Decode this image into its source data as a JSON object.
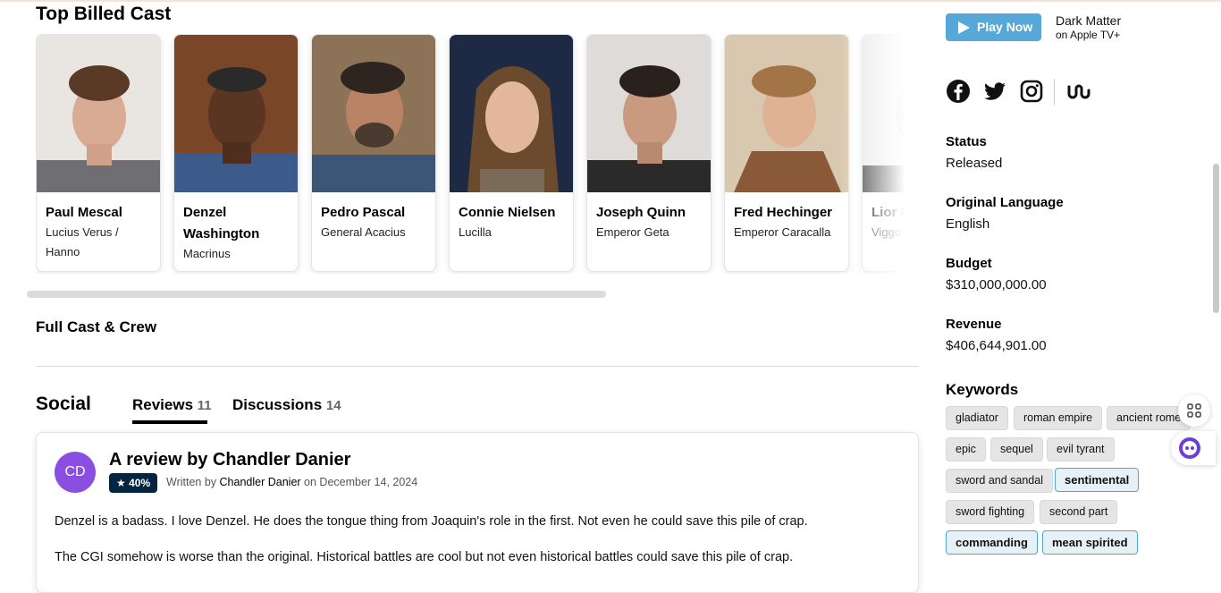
{
  "cast_section": {
    "title": "Top Billed Cast",
    "members": [
      {
        "name": "Paul Mescal",
        "role": "Lucius Verus / Hanno"
      },
      {
        "name": "Denzel Washington",
        "role": "Macrinus"
      },
      {
        "name": "Pedro Pascal",
        "role": "General Acacius"
      },
      {
        "name": "Connie Nielsen",
        "role": "Lucilla"
      },
      {
        "name": "Joseph Quinn",
        "role": "Emperor Geta"
      },
      {
        "name": "Fred Hechinger",
        "role": "Emperor Caracalla"
      },
      {
        "name": "Lior Raz",
        "role": "Viggo"
      }
    ],
    "full_cast_link": "Full Cast & Crew"
  },
  "social": {
    "title": "Social",
    "tabs": [
      {
        "label": "Reviews",
        "count": "11",
        "active": true
      },
      {
        "label": "Discussions",
        "count": "14",
        "active": false
      }
    ],
    "review": {
      "avatar_initials": "CD",
      "title": "A review by Chandler Danier",
      "rating": "★ 40%",
      "written_prefix": "Written by",
      "author": "Chandler Danier",
      "date_text": "on December 14, 2024",
      "paragraphs": [
        "Denzel is a badass. I love Denzel. He does the tongue thing from Joaquin's role in the first. Not even he could save this pile of crap.",
        "The CGI somehow is worse than the original. Historical battles are cool but not even historical battles could save this pile of crap."
      ]
    }
  },
  "sidebar": {
    "play_button": "Play Now",
    "provider_title": "Dark Matter",
    "provider_sub": "on Apple TV+",
    "social_links": [
      "facebook-icon",
      "twitter-icon",
      "instagram-icon",
      "justwatch-icon"
    ],
    "facts": [
      {
        "label": "Status",
        "value": "Released"
      },
      {
        "label": "Original Language",
        "value": "English"
      },
      {
        "label": "Budget",
        "value": "$310,000,000.00"
      },
      {
        "label": "Revenue",
        "value": "$406,644,901.00"
      }
    ],
    "keywords_title": "Keywords",
    "keywords": [
      {
        "label": "gladiator",
        "highlight": false
      },
      {
        "label": "roman empire",
        "highlight": false
      },
      {
        "label": "ancient rome",
        "highlight": false
      },
      {
        "label": "epic",
        "highlight": false
      },
      {
        "label": "sequel",
        "highlight": false
      },
      {
        "label": "evil tyrant",
        "highlight": false
      },
      {
        "label": "sword and sandal",
        "highlight": false
      },
      {
        "label": "sentimental",
        "highlight": true
      },
      {
        "label": "sword fighting",
        "highlight": false
      },
      {
        "label": "second part",
        "highlight": false
      },
      {
        "label": "commanding",
        "highlight": true
      },
      {
        "label": "mean spirited",
        "highlight": true
      }
    ]
  },
  "colors": {
    "accent_blue": "#55a8d8",
    "rating_bg": "#032541",
    "avatar_purple": "#8a4fe0",
    "keyword_bg": "#e5e5e5",
    "keyword_highlight_border": "#4ea6cc"
  }
}
